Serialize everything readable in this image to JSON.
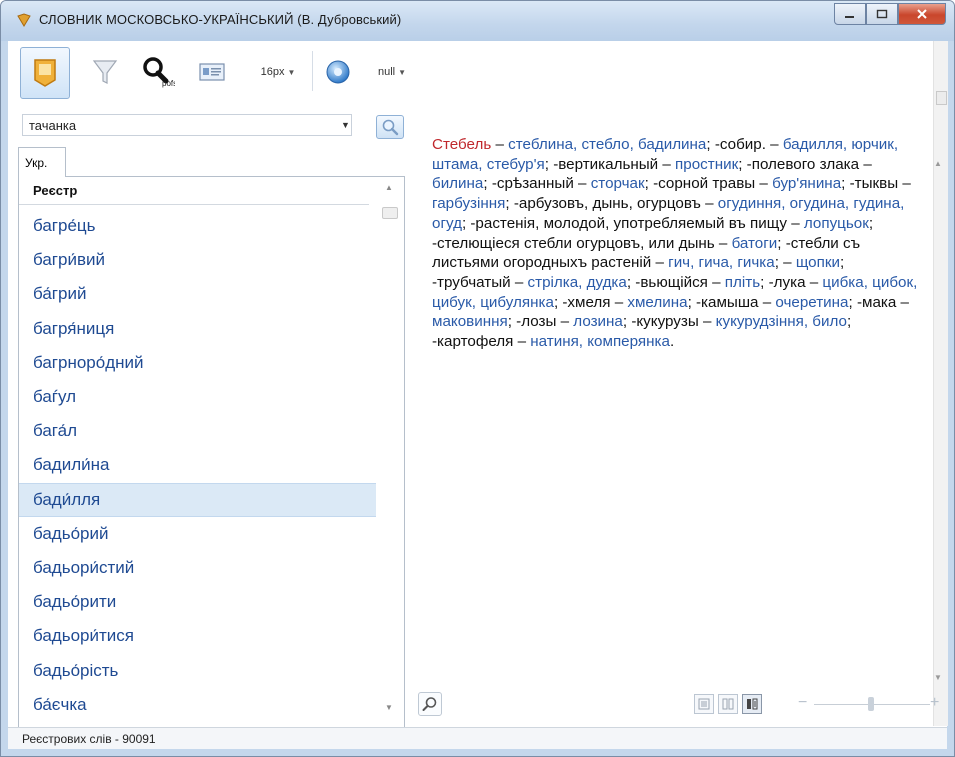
{
  "window": {
    "title": "СЛОВНИК МОСКОВСЬКО-УКРАЇНСЬКИЙ (В. Дубровський)",
    "buttons": [
      "—",
      "□",
      "X"
    ]
  },
  "toolbar": {
    "font_size": "16px",
    "null_label": "null",
    "pofs_caption": "pofs"
  },
  "search": {
    "value": "тачанка"
  },
  "tabs": {
    "ukr": "Укр."
  },
  "list": {
    "header": "Реєстр",
    "items": [
      "багре́ць",
      "багри́вий",
      "ба́грий",
      "багря́ниця",
      "багрноро́дний",
      "баѓул",
      "бага́л",
      "бадили́на",
      "бади́лля",
      "бадьо́рий",
      "бадьори́стий",
      "бадьо́рити",
      "бадьори́тися",
      "бадьо́рість",
      "ба́єчка"
    ],
    "selected_index": 8
  },
  "article": {
    "segments": [
      {
        "t": "Стебель",
        "c": "hw"
      },
      {
        "t": " – ",
        "c": ""
      },
      {
        "t": "стеблина, стебло, бадилина",
        "c": "tr"
      },
      {
        "t": ";  -собир. – ",
        "c": ""
      },
      {
        "t": "бадилля, юрчик, штама, стебур'я",
        "c": "tr"
      },
      {
        "t": ";  -вертикальный – ",
        "c": ""
      },
      {
        "t": "простник",
        "c": "tr"
      },
      {
        "t": ";  -полевого злака – ",
        "c": ""
      },
      {
        "t": "билина",
        "c": "tr"
      },
      {
        "t": ";  -срѣзанный – ",
        "c": ""
      },
      {
        "t": "сторчак",
        "c": "tr"
      },
      {
        "t": ";  -сорной травы – ",
        "c": ""
      },
      {
        "t": "бур'янина",
        "c": "tr"
      },
      {
        "t": ";  -тыквы – ",
        "c": ""
      },
      {
        "t": "гарбузіння",
        "c": "tr"
      },
      {
        "t": ";  -арбузовъ, дынь, огурцовъ – ",
        "c": ""
      },
      {
        "t": "огудиння, огудина, гудина, огуд",
        "c": "tr"
      },
      {
        "t": ";  -растенія, молодой, употребляемый въ пищу – ",
        "c": ""
      },
      {
        "t": "лопуцьок",
        "c": "tr"
      },
      {
        "t": ";  -стелющіеся стебли огурцовъ, или дынь – ",
        "c": ""
      },
      {
        "t": "батоги",
        "c": "tr"
      },
      {
        "t": ";  -стебли съ листьями огородныхъ растеній – ",
        "c": ""
      },
      {
        "t": "гич, гича, гичка",
        "c": "tr"
      },
      {
        "t": ";  – ",
        "c": ""
      },
      {
        "t": "щопки",
        "c": "tr"
      },
      {
        "t": ";  -трубчатый – ",
        "c": ""
      },
      {
        "t": "стрілка, дудка",
        "c": "tr"
      },
      {
        "t": ";  -вьющійся – ",
        "c": ""
      },
      {
        "t": "пліть",
        "c": "tr"
      },
      {
        "t": ";  -лука – ",
        "c": ""
      },
      {
        "t": "цибка, цибок, цибук, цибулянка",
        "c": "tr"
      },
      {
        "t": ";  -хмеля – ",
        "c": ""
      },
      {
        "t": "хмелина",
        "c": "tr"
      },
      {
        "t": ";  -камыша – ",
        "c": ""
      },
      {
        "t": "очеретина",
        "c": "tr"
      },
      {
        "t": ";  -мака – ",
        "c": ""
      },
      {
        "t": "маковиння",
        "c": "tr"
      },
      {
        "t": ";  -лозы – ",
        "c": ""
      },
      {
        "t": "лозина",
        "c": "tr"
      },
      {
        "t": ";  -кукурузы – ",
        "c": ""
      },
      {
        "t": "кукурудзіння, било",
        "c": "tr"
      },
      {
        "t": ";  -картофеля – ",
        "c": ""
      },
      {
        "t": "натиня, комперянка",
        "c": "tr"
      },
      {
        "t": ".",
        "c": ""
      }
    ]
  },
  "status": {
    "text": "Реєстрових слів - 90091"
  },
  "colors": {
    "headword": "#c0282d",
    "translation": "#2a5aa8",
    "list_text": "#1f4a92",
    "selection": "#dbe9f6"
  },
  "icons": [
    "app-icon",
    "bookmark-icon",
    "filter-icon",
    "search-pofs-icon",
    "card-icon",
    "info-circle-icon",
    "search-icon",
    "zoom-icon",
    "layout-single-icon",
    "layout-double-icon",
    "layout-split-icon"
  ]
}
